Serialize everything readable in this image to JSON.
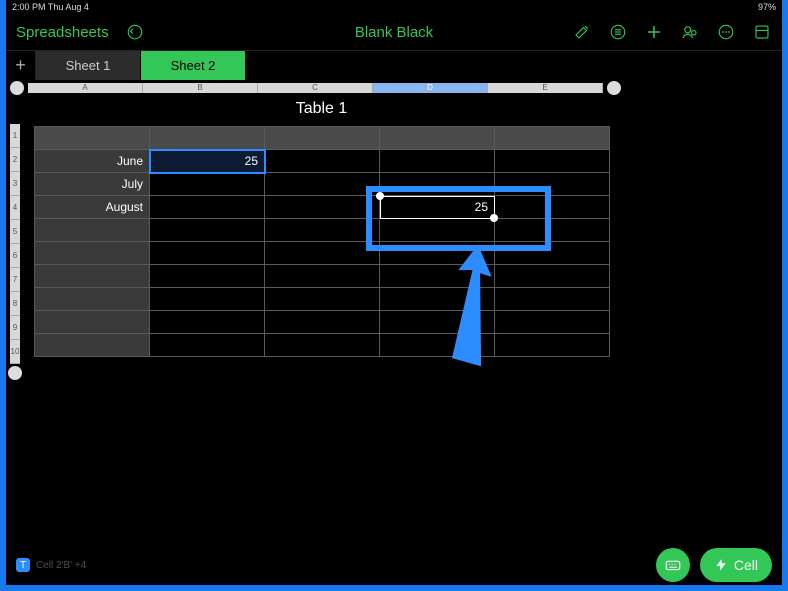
{
  "status": {
    "left": "2:00 PM   Thu Aug 4",
    "right": "97%"
  },
  "toolbar": {
    "back_label": "Spreadsheets",
    "title": "Blank Black"
  },
  "tabs": [
    "Sheet 1",
    "Sheet 2"
  ],
  "active_tab_index": 1,
  "columns": [
    "A",
    "B",
    "C",
    "D",
    "E"
  ],
  "selected_column_index": 3,
  "row_count": 10,
  "table": {
    "title": "Table 1",
    "rows": [
      {
        "label": "June",
        "b": "25",
        "c": "",
        "d": "",
        "e": ""
      },
      {
        "label": "July",
        "b": "",
        "c": "",
        "d": "",
        "e": ""
      },
      {
        "label": "August",
        "b": "",
        "c": "",
        "d": "25",
        "e": ""
      }
    ]
  },
  "highlight_cell": {
    "row_label": "June",
    "col": "B"
  },
  "selected_cell": {
    "row_label": "August",
    "col": "D",
    "value": "25"
  },
  "bottom": {
    "hint": "Cell  2'B'  +4",
    "cell_button": "Cell"
  },
  "icons": {
    "back_circle": "↺",
    "paint": "paint-icon",
    "list": "list-icon",
    "plus": "plus-icon",
    "collab": "collab-icon",
    "more": "more-icon",
    "panel": "panel-icon",
    "keyboard": "keyboard-icon",
    "bolt": "bolt-icon"
  }
}
